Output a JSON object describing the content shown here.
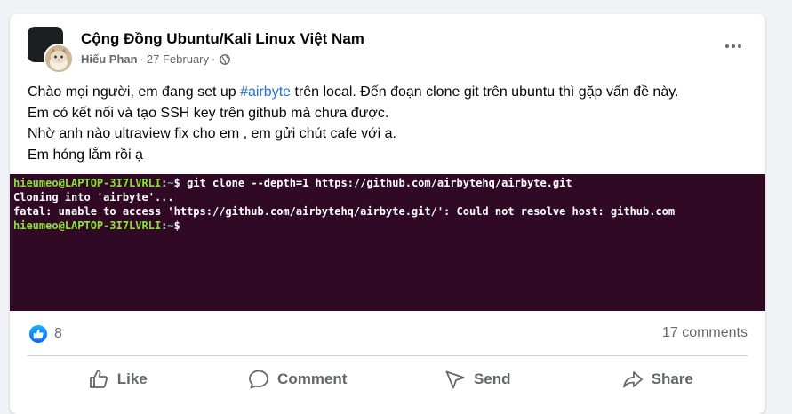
{
  "post": {
    "group_name": "Cộng Đồng Ubuntu/Kali Linux Việt Nam",
    "author": "Hiếu Phan",
    "date": "27 February",
    "separator": "·",
    "icons": {
      "group_avatar": "group-avatar",
      "user_avatar": "cat-avatar",
      "privacy": "globe-icon",
      "more": "more-options-icon"
    },
    "text": {
      "line1_before": "Chào mọi người, em đang set up ",
      "hashtag": "#airbyte",
      "line1_after": " trên local. Đến đoạn clone git trên ubuntu thì gặp vấn đề này.",
      "line2": "Em có kết nối và tạo SSH key trên github mà chưa được.",
      "line3": "Nhờ anh nào ultraview fix cho em , em gửi chút cafe với ạ.",
      "line4": "Em hóng lắm rồi ạ"
    },
    "terminal": {
      "prompt_user": "hieumeo@LAPTOP-3I7LVRLI",
      "prompt_sep": ":",
      "prompt_path": "~",
      "prompt_symbol": "$",
      "command": " git clone --depth=1 https://github.com/airbytehq/airbyte.git",
      "output1": "Cloning into 'airbyte'...",
      "output2": "fatal: unable to access 'https://github.com/airbytehq/airbyte.git/': Could not resolve host: github.com"
    },
    "reactions": {
      "count": "8",
      "comments": "17 comments"
    },
    "actions": {
      "like": "Like",
      "comment": "Comment",
      "send": "Send",
      "share": "Share"
    },
    "colors": {
      "terminal_bg": "#300a24",
      "terminal_user": "#8ae234",
      "terminal_path": "#729fcf",
      "hashtag": "#216fdb",
      "like_blue": "#0866ff"
    }
  }
}
